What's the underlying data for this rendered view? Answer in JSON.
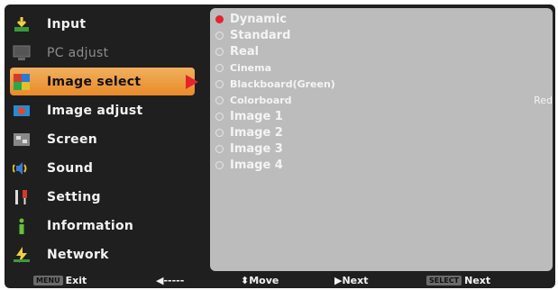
{
  "menu": {
    "items": [
      {
        "label": "Input",
        "icon": "input-icon",
        "state": "normal"
      },
      {
        "label": "PC adjust",
        "icon": "pc-adjust-icon",
        "state": "disabled"
      },
      {
        "label": "Image select",
        "icon": "image-select-icon",
        "state": "selected"
      },
      {
        "label": "Image adjust",
        "icon": "image-adjust-icon",
        "state": "normal"
      },
      {
        "label": "Screen",
        "icon": "screen-icon",
        "state": "normal"
      },
      {
        "label": "Sound",
        "icon": "sound-icon",
        "state": "normal"
      },
      {
        "label": "Setting",
        "icon": "setting-icon",
        "state": "normal"
      },
      {
        "label": "Information",
        "icon": "information-icon",
        "state": "normal"
      },
      {
        "label": "Network",
        "icon": "network-icon",
        "state": "normal"
      }
    ]
  },
  "submenu": {
    "items": [
      {
        "label": "Dynamic",
        "selected": true
      },
      {
        "label": "Standard",
        "selected": false
      },
      {
        "label": "Real",
        "selected": false
      },
      {
        "label": "Cinema",
        "selected": false
      },
      {
        "label": "Blackboard(Green)",
        "selected": false
      },
      {
        "label": "Colorboard",
        "selected": false,
        "value": "Red"
      },
      {
        "label": "Image 1",
        "selected": false
      },
      {
        "label": "Image 2",
        "selected": false
      },
      {
        "label": "Image 3",
        "selected": false
      },
      {
        "label": "Image 4",
        "selected": false
      }
    ]
  },
  "bottombar": {
    "menu_key": "MENU",
    "exit_label": "Exit",
    "back_label": "◀-----",
    "move_label": "⬍Move",
    "next_label": "▶Next",
    "select_key": "SELECT",
    "select_next_label": "Next"
  },
  "colors": {
    "background": "#1f1f1f",
    "submenu_panel": "#bcbcbc",
    "highlight": "#e98a2a",
    "active_radio": "#e5232b"
  }
}
